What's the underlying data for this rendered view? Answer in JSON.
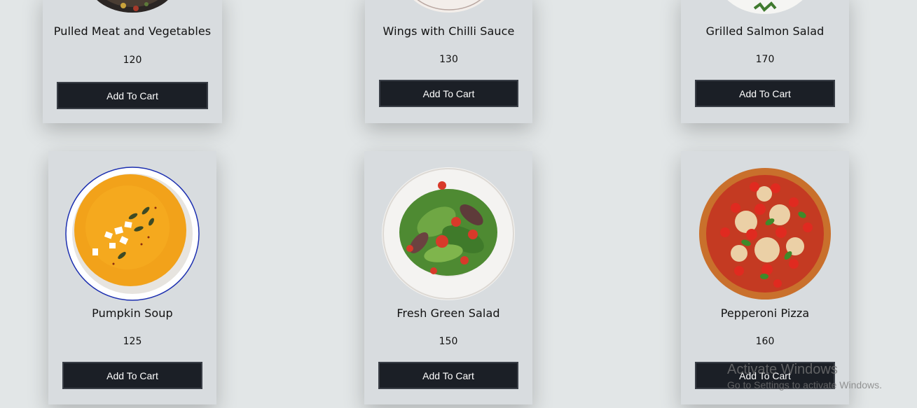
{
  "products": [
    {
      "name": "Pulled Meat and Vegetables",
      "price": "120",
      "button": "Add To Cart"
    },
    {
      "name": "Wings with Chilli Sauce",
      "price": "130",
      "button": "Add To Cart"
    },
    {
      "name": "Grilled Salmon Salad",
      "price": "170",
      "button": "Add To Cart"
    },
    {
      "name": "Pumpkin Soup",
      "price": "125",
      "button": "Add To Cart"
    },
    {
      "name": "Fresh Green Salad",
      "price": "150",
      "button": "Add To Cart"
    },
    {
      "name": "Pepperoni Pizza",
      "price": "160",
      "button": "Add To Cart"
    }
  ],
  "watermark": {
    "title": "Activate Windows",
    "subtitle": "Go to Settings to activate Windows."
  }
}
